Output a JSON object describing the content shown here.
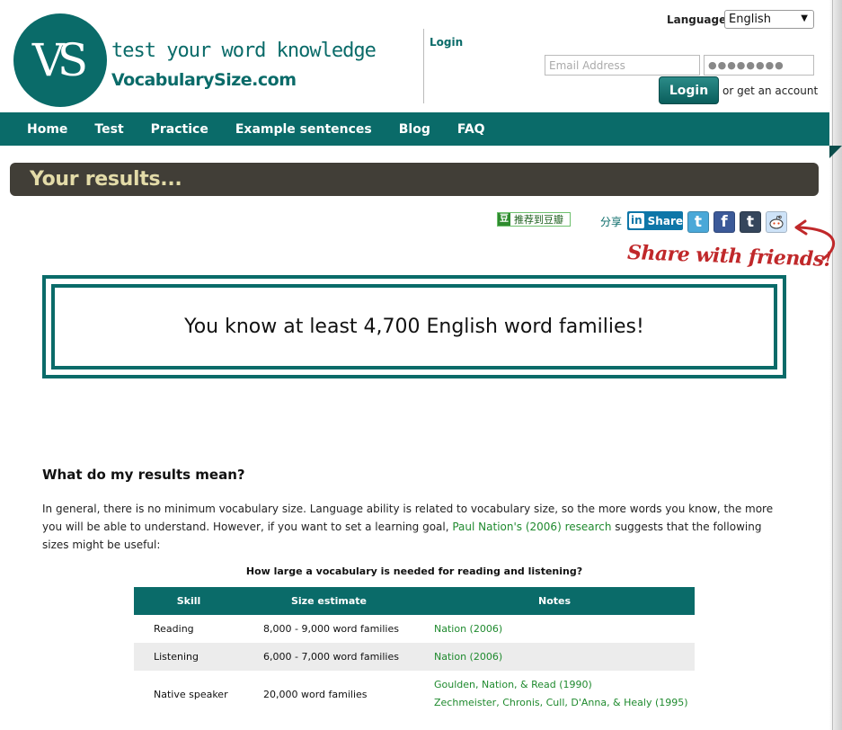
{
  "logo": {
    "initials": "VS"
  },
  "header": {
    "tagline": "test your word knowledge",
    "site_name": "VocabularySize.com",
    "login_title": "Login",
    "language_label": "Language:",
    "language_selected": "English",
    "email_placeholder": "Email Address",
    "password_mask": "●●●●●●●●",
    "login_button": "Login",
    "get_account": "or get an account"
  },
  "nav": {
    "items": [
      "Home",
      "Test",
      "Practice",
      "Example sentences",
      "Blog",
      "FAQ"
    ]
  },
  "page_title": "Your results...",
  "share": {
    "douban": "推荐到豆瓣",
    "share_label": "分享",
    "linkedin": "Share",
    "callout": "Share with friends!"
  },
  "result": {
    "text": "You know at least 4,700 English word families!"
  },
  "explanation": {
    "heading": "What do my results mean?",
    "intro_before": "In general, there is no minimum vocabulary size. Language ability is related to vocabulary size, so the more words you know, the more you will be able to understand. However, if you want to set a learning goal, ",
    "intro_link": "Paul Nation's (2006) research",
    "intro_after": " suggests that the following sizes might be useful:"
  },
  "table": {
    "caption": "How large a vocabulary is needed for reading and listening?",
    "headers": [
      "Skill",
      "Size estimate",
      "Notes"
    ],
    "rows": [
      {
        "skill": "Reading",
        "size": "8,000 - 9,000 word families",
        "notes": [
          "Nation (2006)"
        ]
      },
      {
        "skill": "Listening",
        "size": "6,000 - 7,000 word families",
        "notes": [
          "Nation (2006)"
        ]
      },
      {
        "skill": "Native speaker",
        "size": "20,000 word families",
        "notes": [
          "Goulden, Nation, & Read (1990)",
          "Zechmeister, Chronis, Cull, D'Anna, & Healy (1995)"
        ]
      }
    ]
  }
}
